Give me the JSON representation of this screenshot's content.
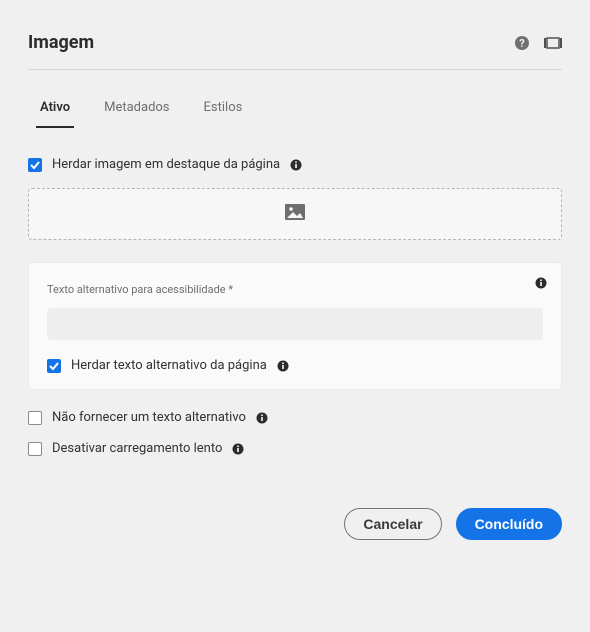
{
  "header": {
    "title": "Imagem"
  },
  "tabs": [
    {
      "label": "Ativo",
      "active": true
    },
    {
      "label": "Metadados",
      "active": false
    },
    {
      "label": "Estilos",
      "active": false
    }
  ],
  "inherit_featured": {
    "label": "Herdar imagem em destaque da página",
    "checked": true
  },
  "alt_panel": {
    "field_label": "Texto alternativo para acessibilidade *",
    "value": "",
    "placeholder": "",
    "inherit_alt": {
      "label": "Herdar texto alternativo da página",
      "checked": true
    }
  },
  "no_alt": {
    "label": "Não fornecer um texto alternativo",
    "checked": false
  },
  "disable_lazy": {
    "label": "Desativar carregamento lento",
    "checked": false
  },
  "footer": {
    "cancel": "Cancelar",
    "done": "Concluído"
  }
}
